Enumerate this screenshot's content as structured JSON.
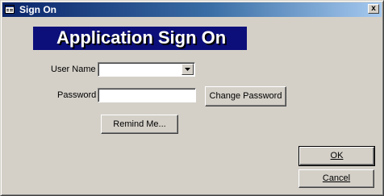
{
  "window": {
    "title": "Sign On",
    "close_glyph": "x"
  },
  "banner": {
    "title": "Application Sign On",
    "background": "#0c0f7a"
  },
  "form": {
    "username_label": "User Name",
    "username_value": "",
    "password_label": "Password",
    "password_value": ""
  },
  "buttons": {
    "change_password": "Change Password",
    "remind_me": "Remind Me...",
    "ok": "OK",
    "cancel": "Cancel"
  },
  "icons": {
    "app": "form-icon",
    "combo": "chevron-down-icon",
    "close": "close-icon"
  }
}
